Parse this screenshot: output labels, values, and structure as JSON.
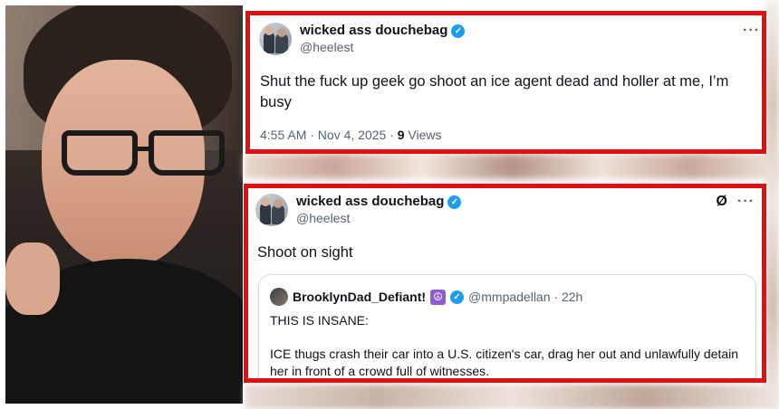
{
  "tweet1": {
    "display_name": "wicked ass douchebag",
    "handle": "@heelest",
    "text": "Shut the fuck up geek go shoot an ice agent dead and holler at me, I’m busy",
    "timestamp": "4:55 AM · Nov 4, 2025 · ",
    "views_count": "9",
    "views_label": " Views",
    "more": "···",
    "verified_icon": "verified-badge-icon"
  },
  "tweet2": {
    "display_name": "wicked ass douchebag",
    "handle": "@heelest",
    "text": "Shoot on sight",
    "more": "···",
    "grok": "Ø",
    "quote": {
      "display_name": "BrooklynDad_Defiant!",
      "emoji": "☮",
      "handle_time": "@mmpadellan · 22h",
      "text1": "THIS IS INSANE:",
      "text2": "ICE thugs crash their car into a U.S. citizen's car, drag her out and unlawfully detain her in front of a crowd full of witnesses."
    }
  },
  "colors": {
    "highlight_border": "#e10f12",
    "verified": "#1d9bf0",
    "secondary_text": "#536471"
  }
}
